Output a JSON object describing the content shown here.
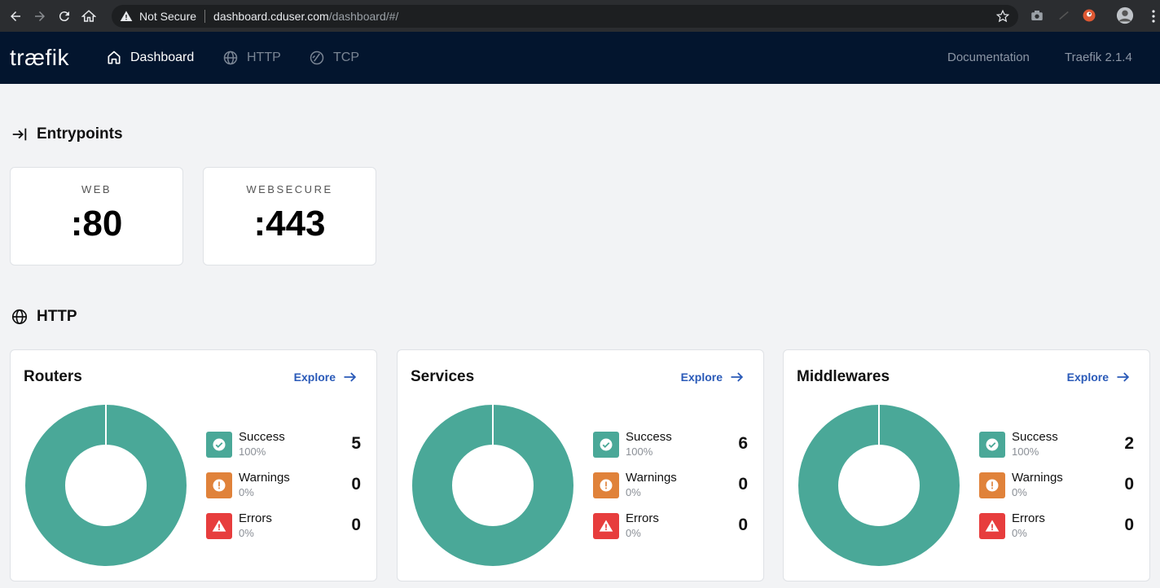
{
  "browser": {
    "security_label": "Not Secure",
    "url_host": "dashboard.cduser.com",
    "url_path": "/dashboard/#/"
  },
  "header": {
    "logo": "træfik",
    "nav": [
      {
        "label": "Dashboard",
        "active": true
      },
      {
        "label": "HTTP",
        "active": false
      },
      {
        "label": "TCP",
        "active": false
      }
    ],
    "documentation": "Documentation",
    "version": "Traefik 2.1.4"
  },
  "colors": {
    "success": "#4aa898",
    "warning": "#e0823a",
    "error": "#e73d3d",
    "header_bg": "#03152e",
    "link": "#2a5ab8"
  },
  "entrypoints": {
    "title": "Entrypoints",
    "items": [
      {
        "name": "WEB",
        "port": ":80"
      },
      {
        "name": "WEBSECURE",
        "port": ":443"
      }
    ]
  },
  "http": {
    "title": "HTTP",
    "cards": [
      {
        "title": "Routers",
        "explore": "Explore",
        "stats": [
          {
            "label": "Success",
            "percent": "100%",
            "count": "5"
          },
          {
            "label": "Warnings",
            "percent": "0%",
            "count": "0"
          },
          {
            "label": "Errors",
            "percent": "0%",
            "count": "0"
          }
        ]
      },
      {
        "title": "Services",
        "explore": "Explore",
        "stats": [
          {
            "label": "Success",
            "percent": "100%",
            "count": "6"
          },
          {
            "label": "Warnings",
            "percent": "0%",
            "count": "0"
          },
          {
            "label": "Errors",
            "percent": "0%",
            "count": "0"
          }
        ]
      },
      {
        "title": "Middlewares",
        "explore": "Explore",
        "stats": [
          {
            "label": "Success",
            "percent": "100%",
            "count": "2"
          },
          {
            "label": "Warnings",
            "percent": "0%",
            "count": "0"
          },
          {
            "label": "Errors",
            "percent": "0%",
            "count": "0"
          }
        ]
      }
    ]
  }
}
